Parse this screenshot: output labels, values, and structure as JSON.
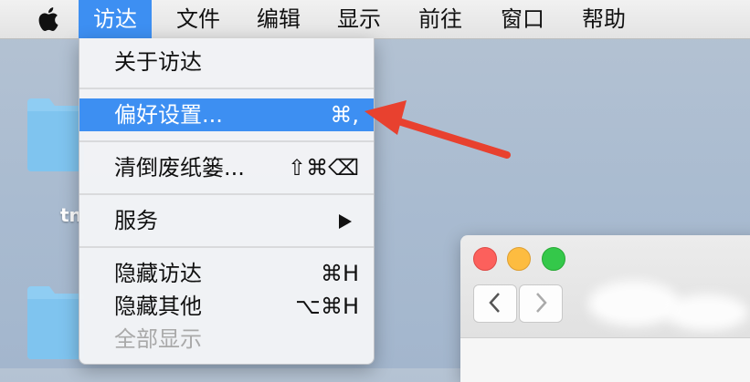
{
  "menubar": {
    "items": [
      "访达",
      "文件",
      "编辑",
      "显示",
      "前往",
      "窗口",
      "帮助"
    ],
    "active_item": "访达"
  },
  "menu": {
    "items": [
      {
        "label": "关于访达",
        "shortcut": ""
      },
      {
        "label": "偏好设置...",
        "shortcut": "⌘,",
        "highlighted": true
      },
      {
        "label": "清倒废纸篓...",
        "shortcut": "⇧⌘⌫"
      },
      {
        "label": "服务",
        "submenu": true
      },
      {
        "label": "隐藏访达",
        "shortcut": "⌘H"
      },
      {
        "label": "隐藏其他",
        "shortcut": "⌥⌘H"
      },
      {
        "label": "全部显示",
        "disabled": true
      }
    ]
  },
  "desktop": {
    "folder_label_fragment": "tn"
  },
  "colors": {
    "highlight": "#3d8ff2",
    "annotation_arrow": "#e8412f",
    "folder": "#7fc4ef"
  },
  "icons": [
    "apple-icon",
    "folder-icon",
    "submenu-arrow-icon",
    "back-chevron-icon",
    "forward-chevron-icon",
    "red-arrow-annotation"
  ]
}
